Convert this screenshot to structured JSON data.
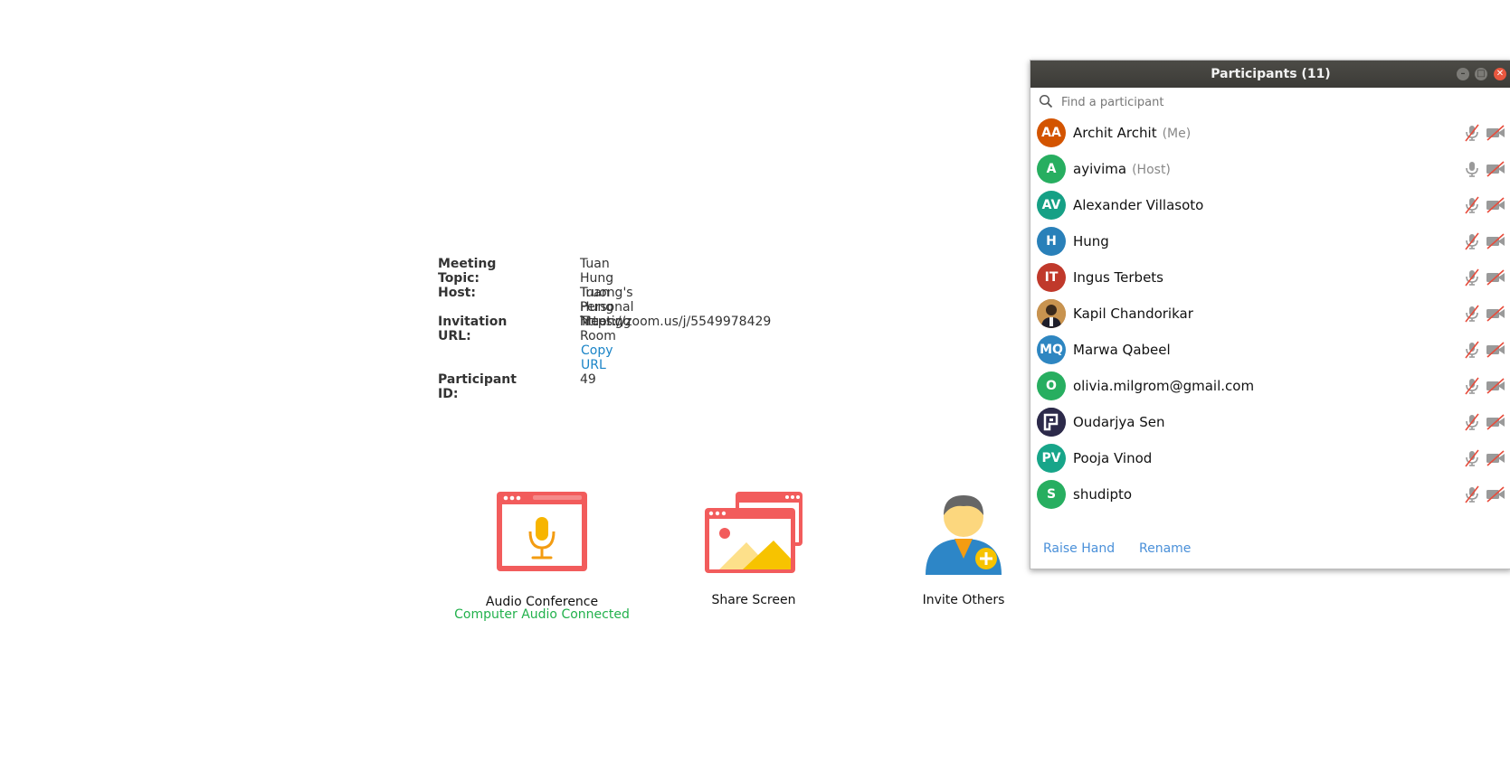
{
  "meeting": {
    "topic_label": "Meeting Topic:",
    "topic_value": "Tuan Hung Truong's Personal Meeting Room",
    "host_label": "Host:",
    "host_value": "Tuan Hung Truong",
    "url_label": "Invitation URL:",
    "url_value": "https://zoom.us/j/5549978429",
    "copy_url": "Copy URL",
    "pid_label": "Participant ID:",
    "pid_value": "49"
  },
  "actions": {
    "audio": {
      "label": "Audio Conference",
      "status": "Computer Audio Connected",
      "icon": "audio-conference-icon"
    },
    "share": {
      "label": "Share Screen",
      "icon": "share-screen-icon"
    },
    "invite": {
      "label": "Invite Others",
      "icon": "invite-others-icon"
    }
  },
  "participants_window": {
    "title": "Participants (11)",
    "search_placeholder": "Find a participant",
    "raise_hand": "Raise Hand",
    "rename": "Rename",
    "participants": [
      {
        "initials": "AA",
        "name": "Archit Archit",
        "role": "(Me)",
        "color": "#d35400",
        "mic": "muted",
        "video": "off"
      },
      {
        "initials": "A",
        "name": "ayivima",
        "role": "(Host)",
        "color": "#27ae60",
        "mic": "on",
        "video": "off"
      },
      {
        "initials": "AV",
        "name": "Alexander Villasoto",
        "role": "",
        "color": "#16a085",
        "mic": "muted",
        "video": "off"
      },
      {
        "initials": "H",
        "name": "Hung",
        "role": "",
        "color": "#2980b9",
        "mic": "muted",
        "video": "off"
      },
      {
        "initials": "IT",
        "name": "Ingus Terbets",
        "role": "",
        "color": "#c0392b",
        "mic": "muted",
        "video": "off"
      },
      {
        "initials": "",
        "name": "Kapil Chandorikar",
        "role": "",
        "color": "#b0733a",
        "avatar": "photo",
        "mic": "muted",
        "video": "off"
      },
      {
        "initials": "MQ",
        "name": "Marwa Qabeel",
        "role": "",
        "color": "#2e86c1",
        "mic": "muted",
        "video": "off"
      },
      {
        "initials": "O",
        "name": "olivia.milgrom@gmail.com",
        "role": "",
        "color": "#27ae60",
        "mic": "muted",
        "video": "off"
      },
      {
        "initials": "",
        "name": "Oudarjya Sen",
        "role": "",
        "color": "#2c2a4a",
        "avatar": "logo",
        "mic": "muted",
        "video": "off"
      },
      {
        "initials": "PV",
        "name": "Pooja Vinod",
        "role": "",
        "color": "#17a589",
        "mic": "muted",
        "video": "off"
      },
      {
        "initials": "S",
        "name": "shudipto",
        "role": "",
        "color": "#27ae60",
        "mic": "muted",
        "video": "off"
      }
    ]
  }
}
